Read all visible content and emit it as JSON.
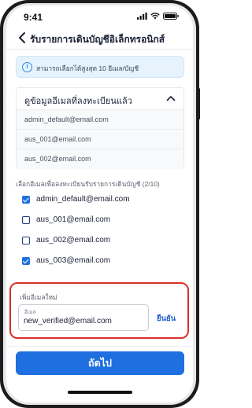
{
  "status_bar": {
    "time": "9:41"
  },
  "header": {
    "title": "รับรายการเดินบัญชีอิเล็กทรอนิกส์"
  },
  "info_banner": {
    "text": "สามารถเลือกได้สูงสุด 10 อีเมล/บัญชี"
  },
  "registered": {
    "title": "ดูข้อมูลอีเมลที่ลงทะเบียนแล้ว",
    "emails": [
      "admin_default@email.com",
      "aus_001@email.com",
      "aus_002@email.com"
    ]
  },
  "selection": {
    "label": "เลือกอีเมลเพื่อลงทะเบียนรับรายการเดินบัญชี (2/10)",
    "options": [
      {
        "email": "admin_default@email.com",
        "checked": true
      },
      {
        "email": "aus_001@email.com",
        "checked": false
      },
      {
        "email": "aus_002@email.com",
        "checked": false
      },
      {
        "email": "aus_003@email.com",
        "checked": true
      }
    ]
  },
  "add_email": {
    "section_label": "เพิ่มอีเมลใหม่",
    "field_label": "อีเมล",
    "value": "new_verified@email.com",
    "confirm_label": "ยืนยัน"
  },
  "footer": {
    "next_label": "ถัดไป"
  },
  "colors": {
    "primary": "#1f6fe0",
    "highlight_border": "#d9302c",
    "info_bg": "#e6f3fd"
  }
}
